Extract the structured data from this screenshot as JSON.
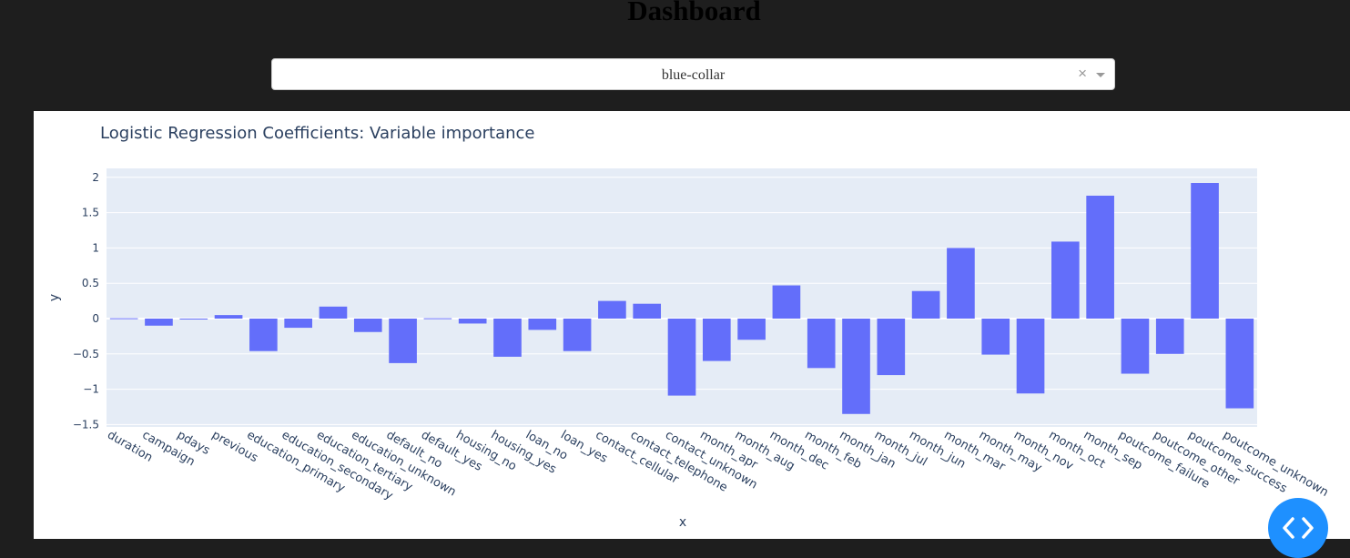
{
  "header": {
    "title": "Dashboard"
  },
  "dropdown": {
    "selected": "blue-collar",
    "clear_label": "×"
  },
  "chart_data": {
    "type": "bar",
    "title": "Logistic Regression Coefficients: Variable importance",
    "xlabel": "x",
    "ylabel": "y",
    "ylim": [
      -1.55,
      2.1
    ],
    "yticks": [
      2,
      1.5,
      1,
      0.5,
      0,
      -0.5,
      -1,
      -1.5
    ],
    "ytick_labels": [
      "2",
      "1.5",
      "1",
      "0.5",
      "0",
      "−0.5",
      "−1",
      "−1.5"
    ],
    "grid": true,
    "bar_color": "#636efa",
    "plot_bg": "#e5ecf6",
    "categories": [
      "duration",
      "campaign",
      "pdays",
      "previous",
      "education_primary",
      "education_secondary",
      "education_tertiary",
      "education_unknown",
      "default_no",
      "default_yes",
      "housing_no",
      "housing_yes",
      "loan_no",
      "loan_yes",
      "contact_cellular",
      "contact_telephone",
      "contact_unknown",
      "month_apr",
      "month_aug",
      "month_dec",
      "month_feb",
      "month_jan",
      "month_jul",
      "month_jun",
      "month_mar",
      "month_may",
      "month_nov",
      "month_oct",
      "month_sep",
      "poutcome_failure",
      "poutcome_other",
      "poutcome_success",
      "poutcome_unknown"
    ],
    "values": [
      0.005,
      -0.1,
      0.0,
      0.05,
      -0.46,
      -0.13,
      0.17,
      -0.19,
      -0.63,
      0.005,
      -0.07,
      -0.54,
      -0.16,
      -0.46,
      0.25,
      0.21,
      -1.09,
      -0.6,
      -0.3,
      0.47,
      -0.7,
      -1.35,
      -0.8,
      0.39,
      1.0,
      -0.51,
      -1.06,
      1.09,
      1.74,
      -0.78,
      -0.5,
      1.92,
      -1.27
    ]
  }
}
